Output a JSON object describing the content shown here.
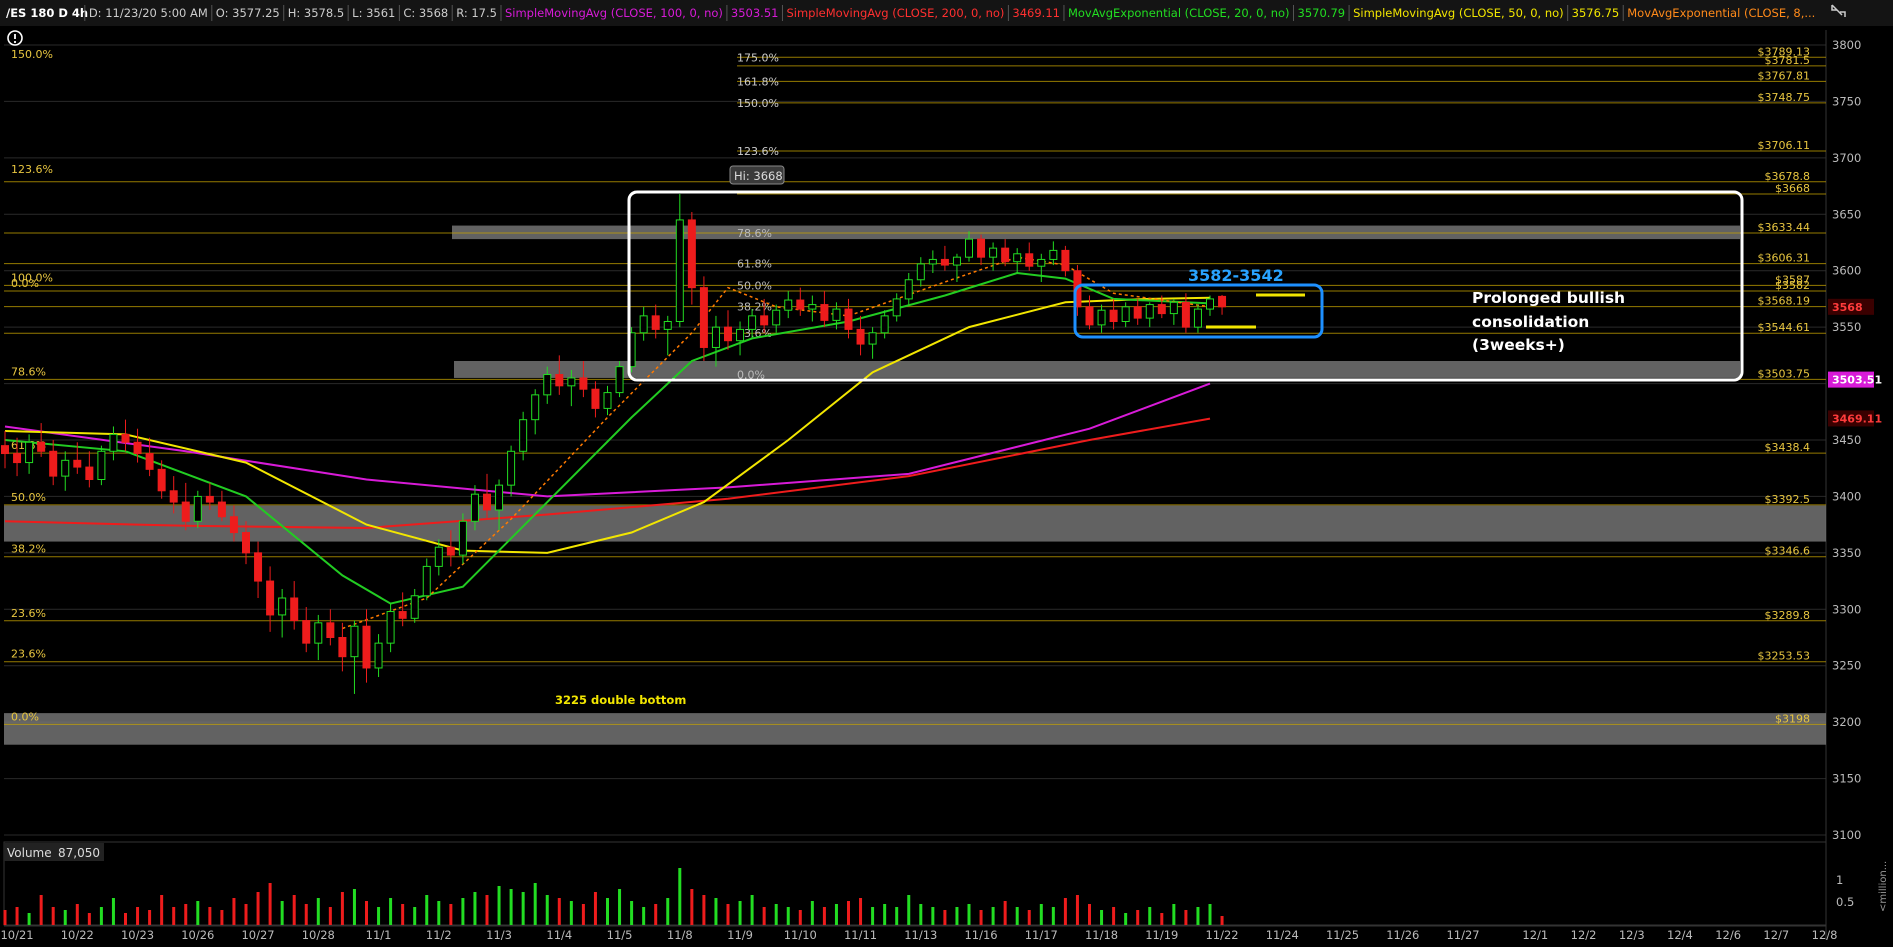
{
  "header": {
    "items": [
      {
        "text": "/ES 180 D 4h",
        "color": "#ffffff"
      },
      {
        "text": "D: 11/23/20 5:00 AM",
        "color": "#cccccc"
      },
      {
        "text": "O: 3577.25",
        "color": "#cccccc"
      },
      {
        "text": "H: 3578.5",
        "color": "#cccccc"
      },
      {
        "text": "L: 3561",
        "color": "#cccccc"
      },
      {
        "text": "C: 3568",
        "color": "#cccccc"
      },
      {
        "text": "R: 17.5",
        "color": "#cccccc"
      },
      {
        "text": "SimpleMovingAvg (CLOSE, 100, 0, no)",
        "color": "#d81bd8"
      },
      {
        "text": "3503.51",
        "color": "#d81bd8"
      },
      {
        "text": "SimpleMovingAvg (CLOSE, 200, 0, no)",
        "color": "#ff3030"
      },
      {
        "text": "3469.11",
        "color": "#ff3030"
      },
      {
        "text": "MovAvgExponential (CLOSE, 20, 0, no)",
        "color": "#22dd22"
      },
      {
        "text": "3570.79",
        "color": "#22dd22"
      },
      {
        "text": "SimpleMovingAvg (CLOSE, 50, 0, no)",
        "color": "#f2e600"
      },
      {
        "text": "3576.75",
        "color": "#f2e600"
      },
      {
        "text": "MovAvgExponential (CLOSE, 8,...",
        "color": "#ff8a1a"
      }
    ],
    "alert_icon": "alert-circle-icon",
    "expand_icon": "expand-icon"
  },
  "colors": {
    "background": "#000000",
    "grid": "#2a2a2a",
    "fib_line": "#c8a400",
    "fib_text": "#e8c640",
    "sma100": "#d81bd8",
    "sma200": "#ee1c1c",
    "ema20": "#22cc22",
    "sma50": "#f2e600",
    "ema8": "#ff7a00",
    "up": "#22dd22",
    "down": "#ee1c1c",
    "zone": "#7a7a7a",
    "box": "#ffffff",
    "blue_box": "#1e90ff"
  },
  "chart_data": {
    "type": "candlestick",
    "title": "/ES 180 D 4h",
    "ylim": [
      3100,
      3800
    ],
    "y_ticks": [
      3800,
      3750,
      3700,
      3650,
      3600,
      3550,
      3500,
      3450,
      3400,
      3350,
      3300,
      3250,
      3200,
      3150,
      3100
    ],
    "x_ticks": [
      {
        "i": 1,
        "label": "10/21"
      },
      {
        "i": 6,
        "label": "10/22"
      },
      {
        "i": 11,
        "label": "10/23"
      },
      {
        "i": 16,
        "label": "10/26"
      },
      {
        "i": 21,
        "label": "10/27"
      },
      {
        "i": 26,
        "label": "10/28"
      },
      {
        "i": 31,
        "label": "11/1"
      },
      {
        "i": 36,
        "label": "11/2"
      },
      {
        "i": 41,
        "label": "11/3"
      },
      {
        "i": 46,
        "label": "11/4"
      },
      {
        "i": 51,
        "label": "11/5"
      },
      {
        "i": 56,
        "label": "11/8"
      },
      {
        "i": 61,
        "label": "11/9"
      },
      {
        "i": 66,
        "label": "11/10"
      },
      {
        "i": 71,
        "label": "11/11"
      },
      {
        "i": 76,
        "label": "11/13"
      },
      {
        "i": 81,
        "label": "11/16"
      },
      {
        "i": 86,
        "label": "11/17"
      },
      {
        "i": 91,
        "label": "11/18"
      },
      {
        "i": 96,
        "label": "11/19"
      },
      {
        "i": 101,
        "label": "11/22"
      },
      {
        "i": 106,
        "label": "11/24"
      },
      {
        "i": 111,
        "label": "11/25"
      },
      {
        "i": 116,
        "label": "11/26"
      },
      {
        "i": 121,
        "label": "11/27"
      },
      {
        "i": 127,
        "label": "12/1"
      },
      {
        "i": 131,
        "label": "12/2"
      },
      {
        "i": 135,
        "label": "12/3"
      },
      {
        "i": 139,
        "label": "12/4"
      },
      {
        "i": 143,
        "label": "12/6"
      },
      {
        "i": 147,
        "label": "12/7"
      },
      {
        "i": 151,
        "label": "12/8"
      }
    ],
    "ohlc": [
      [
        3445,
        3458,
        3425,
        3438
      ],
      [
        3438,
        3452,
        3418,
        3430
      ],
      [
        3430,
        3455,
        3420,
        3448
      ],
      [
        3448,
        3465,
        3435,
        3440
      ],
      [
        3440,
        3450,
        3410,
        3418
      ],
      [
        3418,
        3440,
        3405,
        3432
      ],
      [
        3432,
        3448,
        3420,
        3426
      ],
      [
        3426,
        3440,
        3408,
        3415
      ],
      [
        3415,
        3445,
        3410,
        3440
      ],
      [
        3440,
        3462,
        3432,
        3455
      ],
      [
        3455,
        3468,
        3440,
        3448
      ],
      [
        3448,
        3460,
        3430,
        3438
      ],
      [
        3438,
        3452,
        3418,
        3424
      ],
      [
        3424,
        3432,
        3398,
        3405
      ],
      [
        3405,
        3418,
        3385,
        3395
      ],
      [
        3395,
        3412,
        3370,
        3378
      ],
      [
        3378,
        3405,
        3372,
        3400
      ],
      [
        3400,
        3412,
        3388,
        3395
      ],
      [
        3395,
        3405,
        3378,
        3382
      ],
      [
        3382,
        3392,
        3360,
        3368
      ],
      [
        3368,
        3378,
        3340,
        3350
      ],
      [
        3350,
        3360,
        3310,
        3325
      ],
      [
        3325,
        3338,
        3280,
        3295
      ],
      [
        3295,
        3318,
        3275,
        3310
      ],
      [
        3310,
        3325,
        3282,
        3290
      ],
      [
        3290,
        3302,
        3262,
        3270
      ],
      [
        3270,
        3295,
        3255,
        3288
      ],
      [
        3288,
        3300,
        3268,
        3275
      ],
      [
        3275,
        3288,
        3245,
        3258
      ],
      [
        3258,
        3290,
        3225,
        3285
      ],
      [
        3285,
        3300,
        3235,
        3248
      ],
      [
        3248,
        3278,
        3240,
        3270
      ],
      [
        3270,
        3305,
        3262,
        3298
      ],
      [
        3298,
        3315,
        3285,
        3292
      ],
      [
        3292,
        3318,
        3288,
        3312
      ],
      [
        3312,
        3345,
        3308,
        3338
      ],
      [
        3338,
        3362,
        3330,
        3355
      ],
      [
        3355,
        3370,
        3338,
        3348
      ],
      [
        3348,
        3385,
        3340,
        3378
      ],
      [
        3378,
        3410,
        3370,
        3402
      ],
      [
        3402,
        3420,
        3380,
        3388
      ],
      [
        3388,
        3415,
        3370,
        3410
      ],
      [
        3410,
        3445,
        3400,
        3440
      ],
      [
        3440,
        3475,
        3432,
        3468
      ],
      [
        3468,
        3495,
        3455,
        3490
      ],
      [
        3490,
        3515,
        3482,
        3508
      ],
      [
        3508,
        3525,
        3490,
        3498
      ],
      [
        3498,
        3512,
        3480,
        3505
      ],
      [
        3505,
        3520,
        3488,
        3495
      ],
      [
        3495,
        3502,
        3470,
        3478
      ],
      [
        3478,
        3498,
        3472,
        3492
      ],
      [
        3492,
        3520,
        3488,
        3515
      ],
      [
        3515,
        3550,
        3510,
        3545
      ],
      [
        3545,
        3568,
        3538,
        3560
      ],
      [
        3560,
        3570,
        3540,
        3548
      ],
      [
        3548,
        3560,
        3525,
        3555
      ],
      [
        3555,
        3668,
        3550,
        3645
      ],
      [
        3645,
        3652,
        3570,
        3585
      ],
      [
        3585,
        3595,
        3520,
        3532
      ],
      [
        3532,
        3560,
        3515,
        3550
      ],
      [
        3550,
        3565,
        3530,
        3538
      ],
      [
        3538,
        3555,
        3525,
        3548
      ],
      [
        3548,
        3566,
        3540,
        3560
      ],
      [
        3560,
        3575,
        3545,
        3552
      ],
      [
        3552,
        3570,
        3545,
        3565
      ],
      [
        3565,
        3582,
        3558,
        3574
      ],
      [
        3574,
        3585,
        3560,
        3566
      ],
      [
        3566,
        3578,
        3555,
        3570
      ],
      [
        3570,
        3582,
        3550,
        3556
      ],
      [
        3556,
        3572,
        3548,
        3566
      ],
      [
        3566,
        3575,
        3540,
        3548
      ],
      [
        3548,
        3560,
        3525,
        3535
      ],
      [
        3535,
        3550,
        3522,
        3545
      ],
      [
        3545,
        3565,
        3540,
        3560
      ],
      [
        3560,
        3580,
        3555,
        3575
      ],
      [
        3575,
        3598,
        3570,
        3592
      ],
      [
        3592,
        3612,
        3586,
        3606
      ],
      [
        3606,
        3618,
        3598,
        3610
      ],
      [
        3610,
        3622,
        3600,
        3605
      ],
      [
        3605,
        3615,
        3590,
        3612
      ],
      [
        3612,
        3635,
        3608,
        3628
      ],
      [
        3628,
        3632,
        3605,
        3612
      ],
      [
        3612,
        3625,
        3600,
        3620
      ],
      [
        3620,
        3628,
        3604,
        3608
      ],
      [
        3608,
        3620,
        3598,
        3615
      ],
      [
        3615,
        3625,
        3600,
        3604
      ],
      [
        3604,
        3615,
        3590,
        3610
      ],
      [
        3610,
        3626,
        3605,
        3618
      ],
      [
        3618,
        3622,
        3595,
        3600
      ],
      [
        3600,
        3605,
        3560,
        3568
      ],
      [
        3568,
        3578,
        3548,
        3552
      ],
      [
        3552,
        3570,
        3545,
        3565
      ],
      [
        3565,
        3575,
        3548,
        3555
      ],
      [
        3555,
        3572,
        3550,
        3568
      ],
      [
        3568,
        3575,
        3552,
        3558
      ],
      [
        3558,
        3572,
        3550,
        3570
      ],
      [
        3570,
        3578,
        3558,
        3562
      ],
      [
        3562,
        3575,
        3552,
        3572
      ],
      [
        3572,
        3580,
        3545,
        3550
      ],
      [
        3550,
        3570,
        3545,
        3566
      ],
      [
        3566,
        3578,
        3560,
        3575
      ],
      [
        3577.25,
        3578.5,
        3561,
        3568
      ]
    ],
    "volume_scale": "millions",
    "volume_label": "Volume",
    "volume_value": "87,050",
    "volume_ticks": [
      1,
      0.5
    ],
    "volume_axis_label": "<million...",
    "volume": [
      0.25,
      0.3,
      0.2,
      0.5,
      0.3,
      0.25,
      0.35,
      0.2,
      0.3,
      0.45,
      0.2,
      0.3,
      0.25,
      0.5,
      0.3,
      0.35,
      0.4,
      0.3,
      0.25,
      0.45,
      0.35,
      0.55,
      0.7,
      0.4,
      0.5,
      0.35,
      0.45,
      0.3,
      0.55,
      0.6,
      0.4,
      0.3,
      0.45,
      0.35,
      0.3,
      0.5,
      0.4,
      0.35,
      0.45,
      0.55,
      0.5,
      0.65,
      0.6,
      0.55,
      0.7,
      0.5,
      0.45,
      0.4,
      0.35,
      0.55,
      0.45,
      0.6,
      0.4,
      0.3,
      0.35,
      0.45,
      0.95,
      0.6,
      0.5,
      0.45,
      0.35,
      0.4,
      0.5,
      0.3,
      0.35,
      0.3,
      0.25,
      0.4,
      0.3,
      0.35,
      0.4,
      0.45,
      0.3,
      0.35,
      0.3,
      0.5,
      0.35,
      0.3,
      0.25,
      0.3,
      0.35,
      0.25,
      0.3,
      0.4,
      0.3,
      0.25,
      0.35,
      0.3,
      0.45,
      0.5,
      0.35,
      0.25,
      0.3,
      0.2,
      0.25,
      0.3,
      0.2,
      0.35,
      0.25,
      0.3,
      0.35,
      0.15
    ],
    "ma_sma100": [
      [
        0,
        3462
      ],
      [
        15,
        3440
      ],
      [
        30,
        3415
      ],
      [
        45,
        3400
      ],
      [
        60,
        3408
      ],
      [
        75,
        3420
      ],
      [
        90,
        3460
      ],
      [
        100,
        3500
      ]
    ],
    "ma_sma200": [
      [
        0,
        3378
      ],
      [
        15,
        3374
      ],
      [
        30,
        3372
      ],
      [
        45,
        3384
      ],
      [
        60,
        3398
      ],
      [
        75,
        3418
      ],
      [
        90,
        3450
      ],
      [
        100,
        3469
      ]
    ],
    "ma_ema20": [
      [
        0,
        3450
      ],
      [
        10,
        3440
      ],
      [
        20,
        3400
      ],
      [
        28,
        3330
      ],
      [
        32,
        3305
      ],
      [
        38,
        3320
      ],
      [
        45,
        3395
      ],
      [
        52,
        3470
      ],
      [
        57,
        3520
      ],
      [
        62,
        3540
      ],
      [
        70,
        3555
      ],
      [
        78,
        3578
      ],
      [
        84,
        3598
      ],
      [
        88,
        3593
      ],
      [
        92,
        3575
      ],
      [
        100,
        3571
      ]
    ],
    "ma_sma50": [
      [
        0,
        3458
      ],
      [
        10,
        3455
      ],
      [
        20,
        3430
      ],
      [
        30,
        3375
      ],
      [
        38,
        3352
      ],
      [
        45,
        3350
      ],
      [
        52,
        3368
      ],
      [
        58,
        3395
      ],
      [
        65,
        3450
      ],
      [
        72,
        3510
      ],
      [
        80,
        3550
      ],
      [
        88,
        3572
      ],
      [
        95,
        3575
      ],
      [
        100,
        3576
      ]
    ],
    "ma_ema8": [
      [
        28,
        3283
      ],
      [
        35,
        3310
      ],
      [
        42,
        3380
      ],
      [
        50,
        3470
      ],
      [
        57,
        3545
      ],
      [
        60,
        3585
      ],
      [
        64,
        3568
      ],
      [
        70,
        3560
      ],
      [
        78,
        3590
      ],
      [
        84,
        3612
      ],
      [
        88,
        3605
      ],
      [
        92,
        3580
      ],
      [
        100,
        3568
      ]
    ],
    "price_labels": [
      {
        "value": 3789.13,
        "text": "$3789.13"
      },
      {
        "value": 3781.5,
        "text": "$3781.5"
      },
      {
        "value": 3767.81,
        "text": "$3767.81"
      },
      {
        "value": 3748.75,
        "text": "$3748.75"
      },
      {
        "value": 3706.11,
        "text": "$3706.11"
      },
      {
        "value": 3678.8,
        "text": "$3678.8"
      },
      {
        "value": 3668,
        "text": "$3668"
      },
      {
        "value": 3633.44,
        "text": "$3633.44"
      },
      {
        "value": 3606.31,
        "text": "$3606.31"
      },
      {
        "value": 3587,
        "text": "$3587"
      },
      {
        "value": 3582,
        "text": "$3582"
      },
      {
        "value": 3568.19,
        "text": "$3568.19"
      },
      {
        "value": 3544.61,
        "text": "$3544.61"
      },
      {
        "value": 3503.75,
        "text": "$3503.75"
      },
      {
        "value": 3438.4,
        "text": "$3438.4"
      },
      {
        "value": 3392.5,
        "text": "$3392.5"
      },
      {
        "value": 3346.6,
        "text": "$3346.6"
      },
      {
        "value": 3289.8,
        "text": "$3289.8"
      },
      {
        "value": 3253.53,
        "text": "$3253.53"
      },
      {
        "value": 3198,
        "text": "$3198"
      }
    ],
    "left_fibs": [
      {
        "value": 3785,
        "text": "150.0%"
      },
      {
        "value": 3683,
        "text": "123.6%"
      },
      {
        "value": 3587,
        "text": "100.0%"
      },
      {
        "value": 3582,
        "text": "0.0%"
      },
      {
        "value": 3503.75,
        "text": "78.6%"
      },
      {
        "value": 3438.4,
        "text": "61.8%"
      },
      {
        "value": 3392.5,
        "text": "50.0%"
      },
      {
        "value": 3346.6,
        "text": "38.2%"
      },
      {
        "value": 3289.8,
        "text": "23.6%"
      },
      {
        "value": 3253.53,
        "text": "23.6%"
      },
      {
        "value": 3198,
        "text": "0.0%"
      }
    ],
    "top_fibs": [
      {
        "value": 3789.13,
        "text": "175.0%"
      },
      {
        "value": 3767.81,
        "text": "161.8%"
      },
      {
        "value": 3748.75,
        "text": "150.0%"
      },
      {
        "value": 3706.11,
        "text": "123.6%"
      }
    ],
    "inner_fibs": [
      {
        "value": 3633.44,
        "text": "78.6%"
      },
      {
        "value": 3606.31,
        "text": "61.8%"
      },
      {
        "value": 3587,
        "text": "50.0%"
      },
      {
        "value": 3568.19,
        "text": "38.2%"
      },
      {
        "value": 3544.61,
        "text": "23.6%"
      },
      {
        "value": 3508,
        "text": "0.0%"
      }
    ],
    "zones": [
      {
        "from": 3628,
        "to": 3640
      },
      {
        "from": 3505,
        "to": 3520
      },
      {
        "from": 3360,
        "to": 3392
      },
      {
        "from": 3180,
        "to": 3208
      }
    ],
    "hi_label": "Hi: 3668",
    "last_price": {
      "value": 3568,
      "text": "3568"
    },
    "sma100_tag": {
      "value": 3503.51,
      "text": "3503.51"
    },
    "sma200_tag": {
      "value": 3469.11,
      "text": "3469.11"
    },
    "annotations": {
      "range": "3582-3542",
      "consolidation": [
        "Prolonged bullish",
        "consolidation",
        "(3weeks+)"
      ],
      "double_bottom": "3225 double bottom"
    }
  }
}
